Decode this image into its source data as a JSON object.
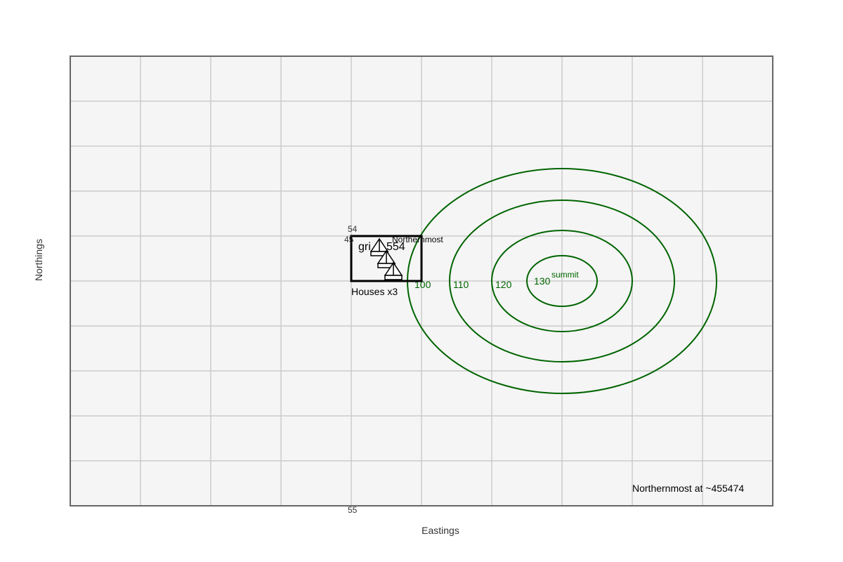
{
  "axes": {
    "x_label": "Eastings",
    "y_label": "Northings",
    "x_tick": "55",
    "y_ticks": [
      "54",
      "45"
    ]
  },
  "grid_square": {
    "label_left": "gri",
    "label_right": "554"
  },
  "settlement": {
    "label": "Houses x3",
    "house_count": 3
  },
  "contours": {
    "color": "#006400",
    "labels": [
      "100",
      "110",
      "120",
      "130"
    ],
    "summit_label": "summit"
  },
  "annotations": {
    "northernmost_tag": "Northernmost",
    "northernmost_note": "Northernmost at ~455474"
  },
  "colors": {
    "map_background": "#f5f5f5",
    "grid_line": "#cccccc",
    "frame": "#666666",
    "contour": "#006400"
  }
}
